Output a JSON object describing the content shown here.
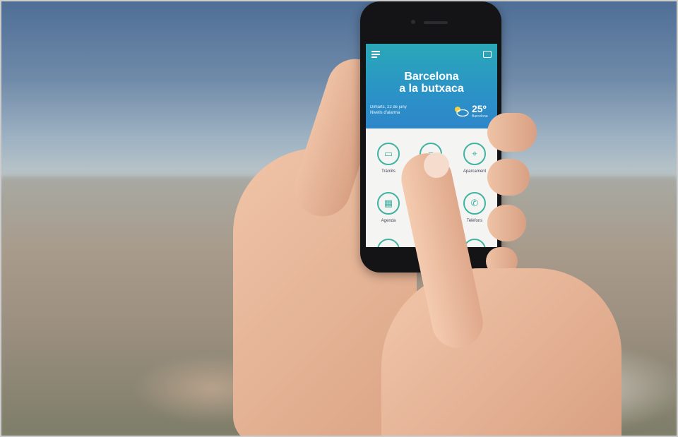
{
  "app": {
    "title_line1": "Barcelona",
    "title_line2": "a la butxaca",
    "date_line1": "Dimarts, 22 de juny",
    "date_line2": "Nivells d'alarma",
    "temperature": "25º",
    "temp_sub": "Barcelona"
  },
  "grid": [
    {
      "label": "Tràmits",
      "icon": "folder-icon"
    },
    {
      "label": "",
      "icon": "document-icon"
    },
    {
      "label": "Aparcament",
      "icon": "location-icon"
    },
    {
      "label": "Agenda",
      "icon": "calendar-icon"
    },
    {
      "label": "",
      "icon": "blank"
    },
    {
      "label": "Telèfons",
      "icon": "phone-icon"
    }
  ],
  "colors": {
    "header_top": "#2aa8b8",
    "header_bottom": "#2e86c9",
    "accent": "#3fb3a2"
  }
}
